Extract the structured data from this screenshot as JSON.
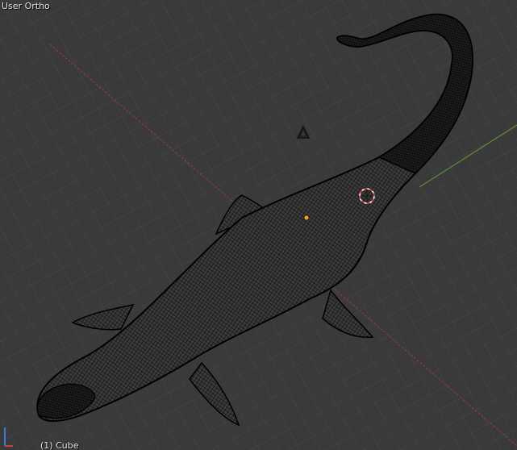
{
  "viewport": {
    "view_label": "User Ortho",
    "object_label": "(1) Cube"
  },
  "colors": {
    "background": "#3a3a3a",
    "grid": "#444444",
    "x_axis": "#9a3c3c",
    "y_axis": "#5e9a3c",
    "mesh_fill": "#2a2a2a",
    "mesh_wire": "#000000",
    "origin": "#f0a030",
    "cursor_red": "#e04040",
    "cursor_white": "#ffffff"
  },
  "icons": [
    "camera-icon",
    "3d-cursor-icon",
    "object-origin-icon",
    "axis-gizmo-icon"
  ]
}
